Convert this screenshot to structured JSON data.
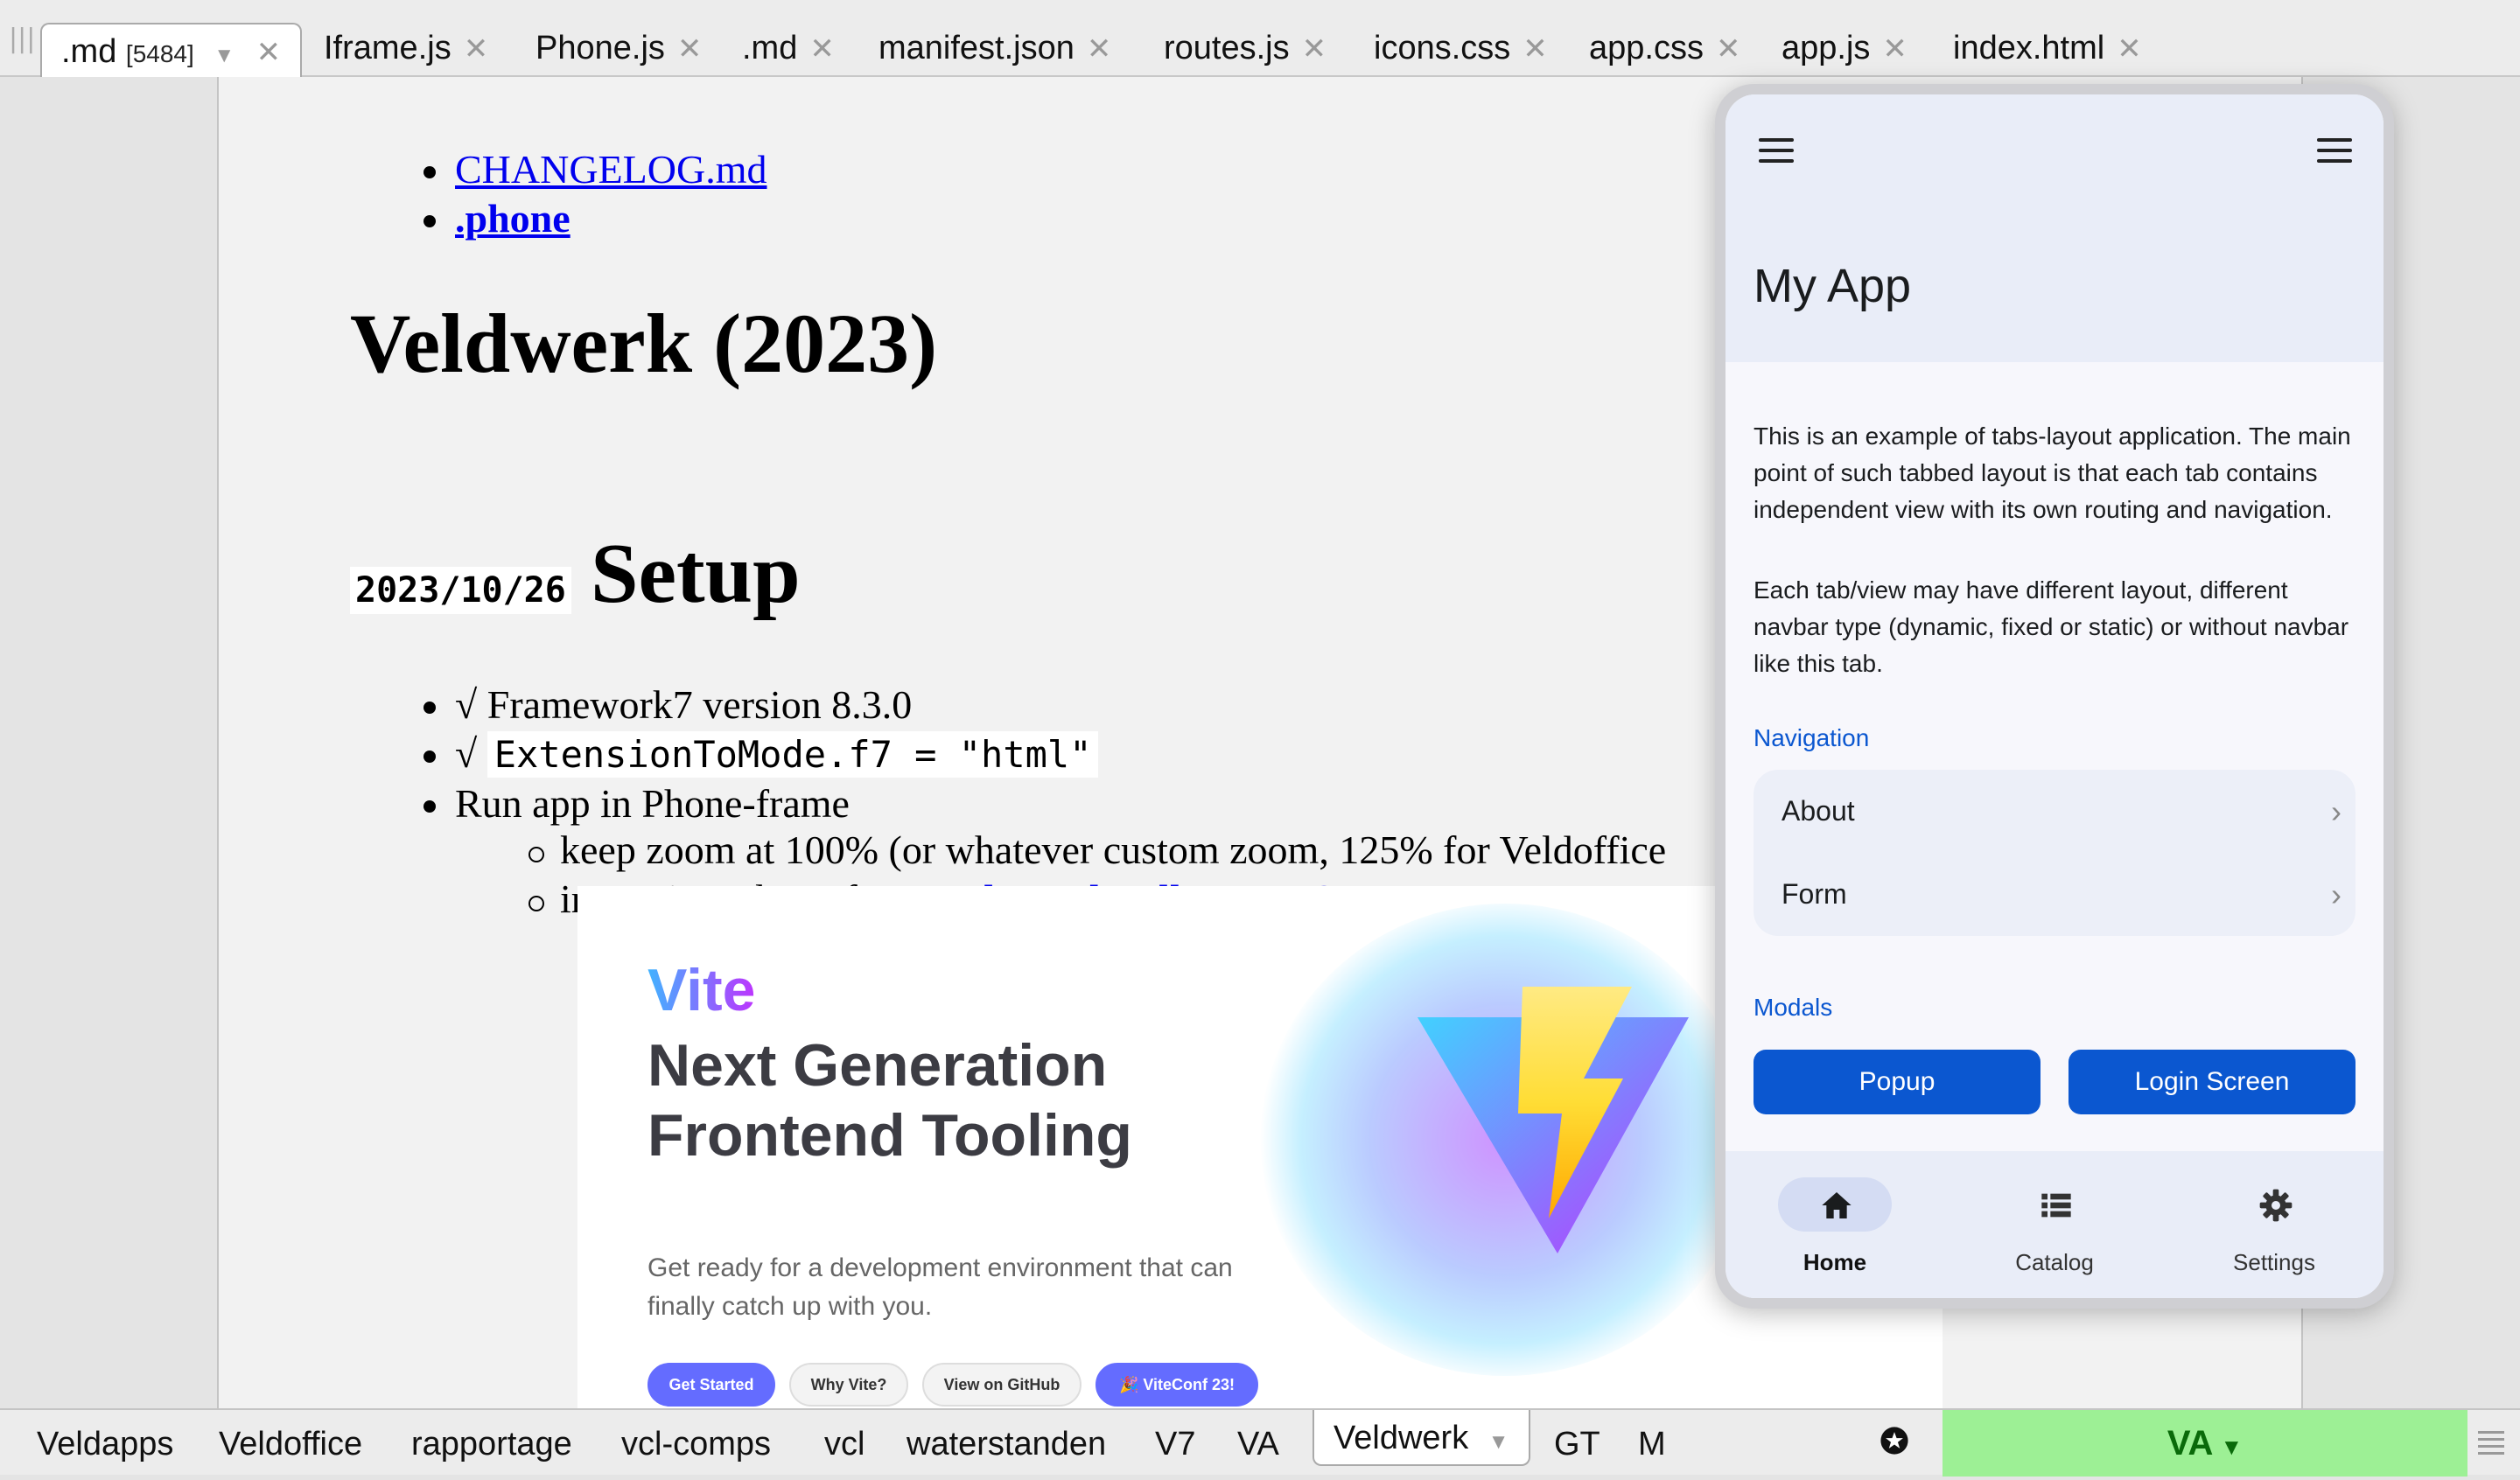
{
  "top_tabs": {
    "active": {
      "label": ".md",
      "badge": "[5484]"
    },
    "tabs": [
      "Iframe.js",
      "Phone.js",
      ".md",
      "manifest.json",
      "routes.js",
      "icons.css",
      "app.css",
      "app.js",
      "index.html"
    ]
  },
  "doc": {
    "links": [
      "CHANGELOG.md",
      ".phone"
    ],
    "heading1": "Veldwerk (2023)",
    "date_code": "2023/10/26",
    "heading2": "Setup",
    "items": {
      "framework": "√ Framework7 version 8.3.0",
      "check": "√",
      "ext_code": "ExtensionToMode.f7 = \"html\"",
      "run": "Run app in Phone-frame"
    },
    "subitems": {
      "zoom": "keep zoom at 100% (or whatever custom zoom, 125% for Veldoffice",
      "instantiate_prefix": "instantiate phone frame: ",
      "instantiate_link": "Phone<localhost:5173>"
    }
  },
  "vite": {
    "name": "Vite",
    "headline": "Next Generation Frontend Tooling",
    "subtitle": "Get ready for a development environment that can finally catch up with you.",
    "buttons": [
      "Get Started",
      "Why Vite?",
      "View on GitHub",
      "🎉 ViteConf 23!"
    ],
    "brand_color": "#646cff"
  },
  "phone": {
    "title": "My App",
    "para1": "This is an example of tabs-layout application. The main point of such tabbed layout is that each tab contains independent view with its own routing and navigation.",
    "para2": "Each tab/view may have different layout, different navbar type (dynamic, fixed or static) or without navbar like this tab.",
    "navigation_title": "Navigation",
    "nav_items": [
      "About",
      "Form"
    ],
    "modals_title": "Modals",
    "modal_buttons": [
      "Popup",
      "Login Screen"
    ],
    "tabbar": [
      {
        "label": "Home",
        "icon": "home-icon",
        "active": true
      },
      {
        "label": "Catalog",
        "icon": "list-icon",
        "active": false
      },
      {
        "label": "Settings",
        "icon": "gear-icon",
        "active": false
      }
    ],
    "accent_color": "#0b57d0"
  },
  "bottom_tabs": {
    "tabs": [
      "Veldapps",
      "Veldoffice",
      "rapportage",
      "vcl-comps",
      "vcl",
      "waterstanden",
      "V7",
      "VA"
    ],
    "active": "Veldwerk",
    "after": [
      "GT",
      "M"
    ],
    "right_label": "VA",
    "right_color": "#9df095"
  }
}
